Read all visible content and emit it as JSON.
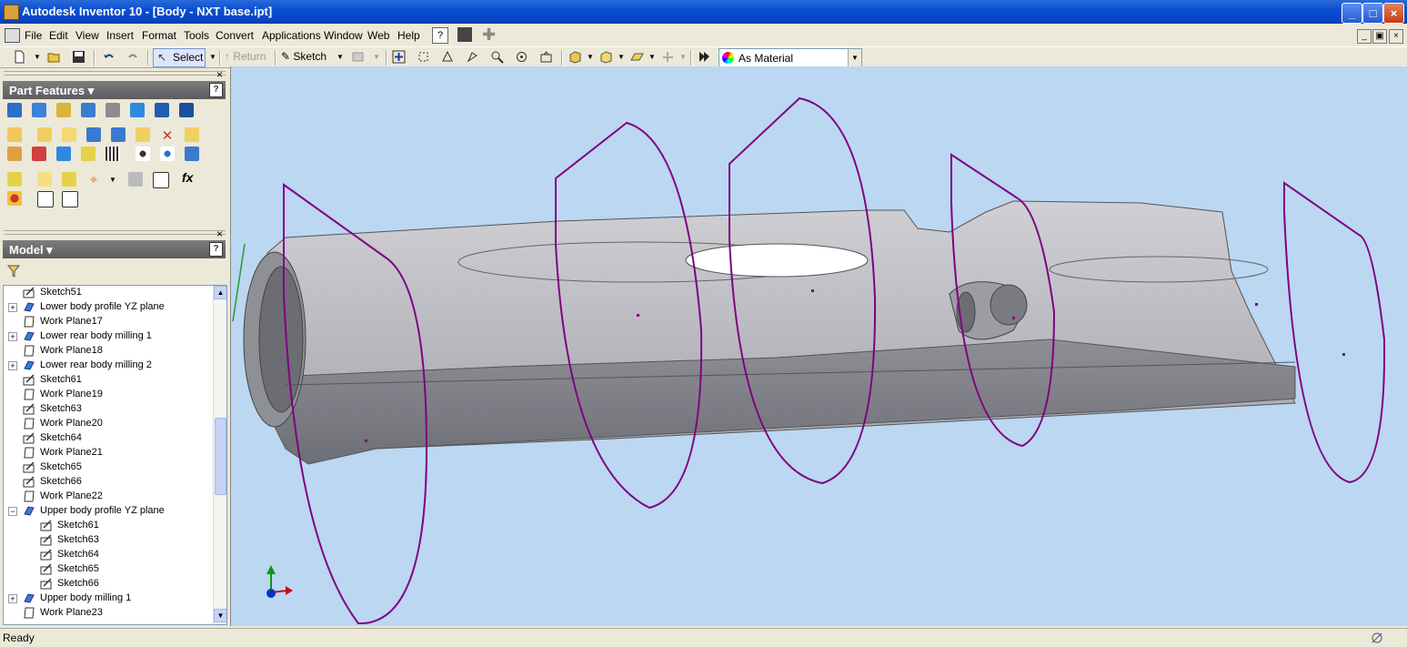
{
  "window": {
    "title": "Autodesk Inventor 10 - [Body - NXT base.ipt]",
    "minimize": "_",
    "maximize": "□",
    "close": "×"
  },
  "menu": {
    "items": [
      "File",
      "Edit",
      "View",
      "Insert",
      "Format",
      "Tools",
      "Convert",
      "Applications",
      "Window",
      "Web",
      "Help"
    ],
    "help_glyph": "?",
    "mdi_restore": "▣",
    "mdi_min": "_",
    "mdi_close": "×"
  },
  "toolbar": {
    "select_label": "Select",
    "return_label": "Return",
    "sketch_label": "Sketch",
    "material_value": "As Material"
  },
  "features_panel": {
    "title": "Part Features ▾",
    "help": "?",
    "close": "×",
    "fx": "fx"
  },
  "model_panel": {
    "title": "Model ▾",
    "help": "?",
    "close": "×",
    "tree": [
      {
        "label": "Sketch51",
        "expander": ""
      },
      {
        "label": "Lower body profile YZ plane",
        "expander": "+"
      },
      {
        "label": "Work Plane17",
        "expander": ""
      },
      {
        "label": "Lower rear body milling 1",
        "expander": "+"
      },
      {
        "label": "Work Plane18",
        "expander": ""
      },
      {
        "label": "Lower rear body milling 2",
        "expander": "+"
      },
      {
        "label": "Sketch61",
        "expander": ""
      },
      {
        "label": "Work Plane19",
        "expander": ""
      },
      {
        "label": "Sketch63",
        "expander": ""
      },
      {
        "label": "Work Plane20",
        "expander": ""
      },
      {
        "label": "Sketch64",
        "expander": ""
      },
      {
        "label": "Work Plane21",
        "expander": ""
      },
      {
        "label": "Sketch65",
        "expander": ""
      },
      {
        "label": "Sketch66",
        "expander": ""
      },
      {
        "label": "Work Plane22",
        "expander": ""
      },
      {
        "label": "Upper body profile YZ plane",
        "expander": "−"
      },
      {
        "label": "Sketch61",
        "expander": ""
      },
      {
        "label": "Sketch63",
        "expander": ""
      },
      {
        "label": "Sketch64",
        "expander": ""
      },
      {
        "label": "Sketch65",
        "expander": ""
      },
      {
        "label": "Sketch66",
        "expander": ""
      },
      {
        "label": "Upper body milling 1",
        "expander": "+"
      },
      {
        "label": "Work Plane23",
        "expander": ""
      }
    ]
  },
  "status": {
    "text": "Ready"
  },
  "colors": {
    "viewport_bg": "#bbd7f2",
    "sketch_profile": "#800080",
    "part_body": "#8d8e95"
  }
}
